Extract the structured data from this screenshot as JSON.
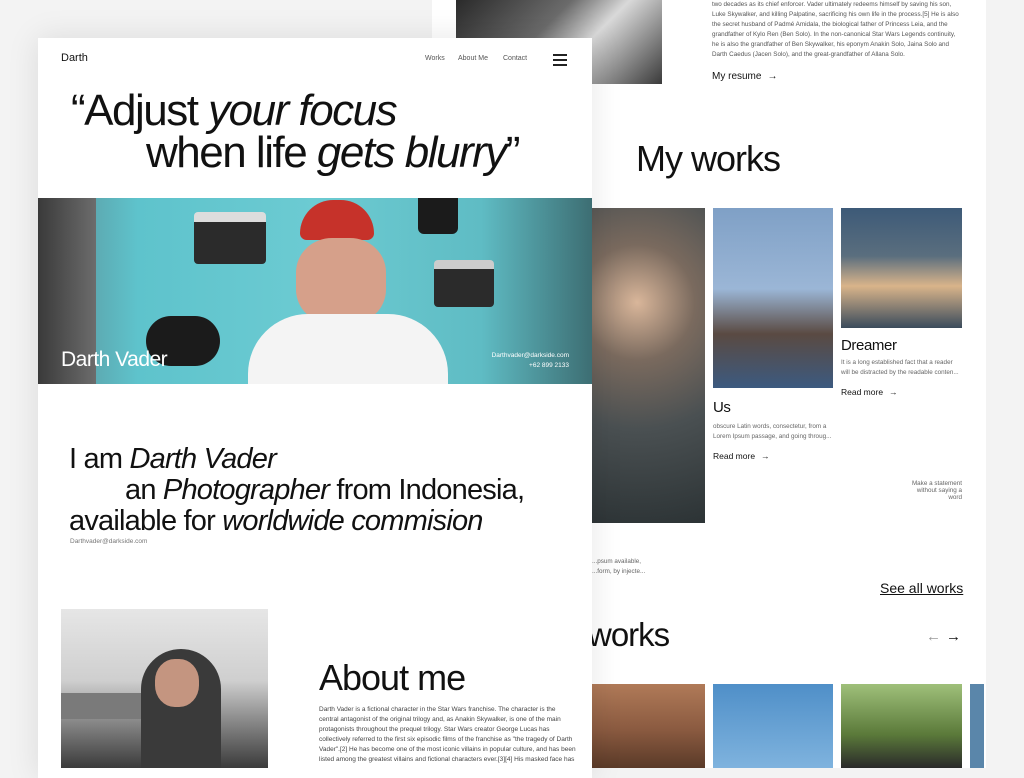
{
  "brand": "Darth",
  "nav": {
    "works": "Works",
    "about": "About Me",
    "contact": "Contact"
  },
  "hero": {
    "quote_line1_a": "“Adjust ",
    "quote_line1_b": "your focus",
    "quote_line2_a": "when life ",
    "quote_line2_b": "gets blurry",
    "quote_line2_c": "”",
    "name": "Darth Vader",
    "email": "Darthvader@darkside.com",
    "phone": "+62 899 2133"
  },
  "intro": {
    "l1a": "I am ",
    "l1b": "Darth Vader",
    "l2a": "an ",
    "l2b": "Photographer",
    "l2c": " from Indonesia,",
    "l3a": "available for ",
    "l3b": "worldwide commision",
    "email": "Darthvader@darkside.com"
  },
  "about": {
    "title": "About me",
    "p1": "Darth Vader is a fictional character in the Star Wars franchise. The character is the",
    "p2": "central antagonist of the original trilogy and, as Anakin Skywalker, is one of the main",
    "p3": "protagonists throughout the prequel trilogy. Star Wars creator George Lucas has",
    "p4": "collectively referred to the first six episodic films of the franchise as \"the tragedy of Darth",
    "p5": "Vader\".[2] He has become one of the most iconic villains in popular culture, and has been",
    "p6": "listed among the greatest villains and fictional characters ever.[3][4] His masked face has"
  },
  "bio": {
    "l1": "two decades as its chief enforcer. Vader ultimately redeems himself by saving his son,",
    "l2": "Luke Skywalker, and killing Palpatine, sacrificing his own life in the process.[5] He is also",
    "l3": "the secret husband of Padmé Amidala, the biological father of Princess Leia, and the",
    "l4": "grandfather of Kylo Ren (Ben Solo). In the non-canonical Star Wars Legends continuity,",
    "l5": "he is also the grandfather of Ben Skywalker, his eponym Anakin Solo, Jaina Solo and",
    "l6": "Darth Caedus (Jacen Solo), and the great-grandfather of Allana Solo.",
    "resume": "My resume"
  },
  "works": {
    "title": "My works",
    "card_us": {
      "title": "Us",
      "d1": "obscure Latin words, consectetur, from a",
      "d2": "Lorem Ipsum passage, and going throug...",
      "more": "Read more"
    },
    "card_dreamer": {
      "title": "Dreamer",
      "d1": "It is a long established fact that a reader",
      "d2": "will be distracted by the readable conten...",
      "more": "Read more"
    },
    "partial1": "...psum available,",
    "partial2": "...form, by injecte...",
    "statement1": "Make a statement",
    "statement2": "without saying a",
    "statement3": "word",
    "see_all": "See all works",
    "section2": "works"
  }
}
